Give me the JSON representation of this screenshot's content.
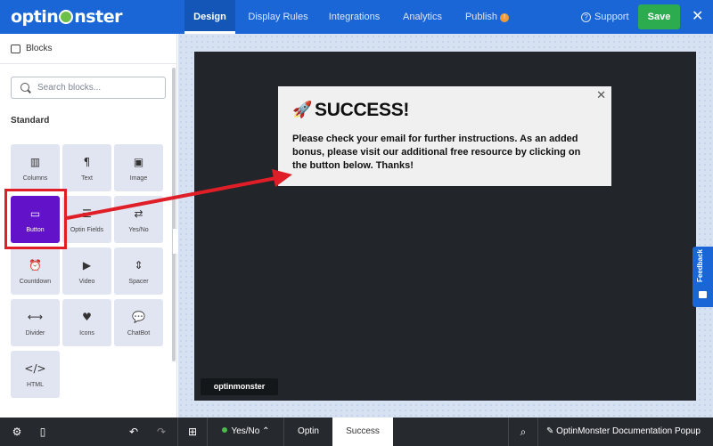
{
  "header": {
    "logo": {
      "before": "optin",
      "after": "nster"
    },
    "tabs": [
      "Design",
      "Display Rules",
      "Integrations",
      "Analytics",
      "Publish"
    ],
    "publish_badge": "!",
    "support": "Support",
    "save": "Save",
    "close": "✕"
  },
  "sidebar": {
    "title": "Blocks",
    "search_placeholder": "Search blocks...",
    "section": "Standard",
    "blocks": [
      {
        "label": "Columns",
        "icon": "columns-icon",
        "glyph": "▥"
      },
      {
        "label": "Text",
        "icon": "paragraph-icon",
        "glyph": "¶"
      },
      {
        "label": "Image",
        "icon": "image-icon",
        "glyph": "▣"
      },
      {
        "label": "Button",
        "icon": "button-icon",
        "glyph": "▭"
      },
      {
        "label": "Optin Fields",
        "icon": "optin-fields-icon",
        "glyph": "☰"
      },
      {
        "label": "Yes/No",
        "icon": "yes-no-icon",
        "glyph": "⇄"
      },
      {
        "label": "Countdown",
        "icon": "alarm-clock-icon",
        "glyph": "⏰"
      },
      {
        "label": "Video",
        "icon": "video-camera-icon",
        "glyph": "▶"
      },
      {
        "label": "Spacer",
        "icon": "spacer-icon",
        "glyph": "⇕"
      },
      {
        "label": "Divider",
        "icon": "divider-icon",
        "glyph": "⟷"
      },
      {
        "label": "Icons",
        "icon": "heart-icon",
        "glyph": "♥"
      },
      {
        "label": "ChatBot",
        "icon": "chat-icon",
        "glyph": "💬"
      },
      {
        "label": "HTML",
        "icon": "code-icon",
        "glyph": "</>"
      }
    ]
  },
  "popup": {
    "rocket": "🚀",
    "title": "SUCCESS!",
    "message": "Please check your email for further instructions. As an added bonus, please visit our additional free resource by clicking on the button below. Thanks!",
    "close": "✕"
  },
  "preview_logo": "optinmonster",
  "feedback": "Feedback",
  "bottom": {
    "view_toggle": "Yes/No",
    "tabs": [
      "Optin",
      "Success"
    ],
    "campaign_title": "OptinMonster Documentation Popup"
  },
  "colors": {
    "brand_blue": "#1a66d6",
    "save_green": "#2cab4f",
    "selected_block": "#6212c8",
    "annotation_red": "#e01e27"
  }
}
